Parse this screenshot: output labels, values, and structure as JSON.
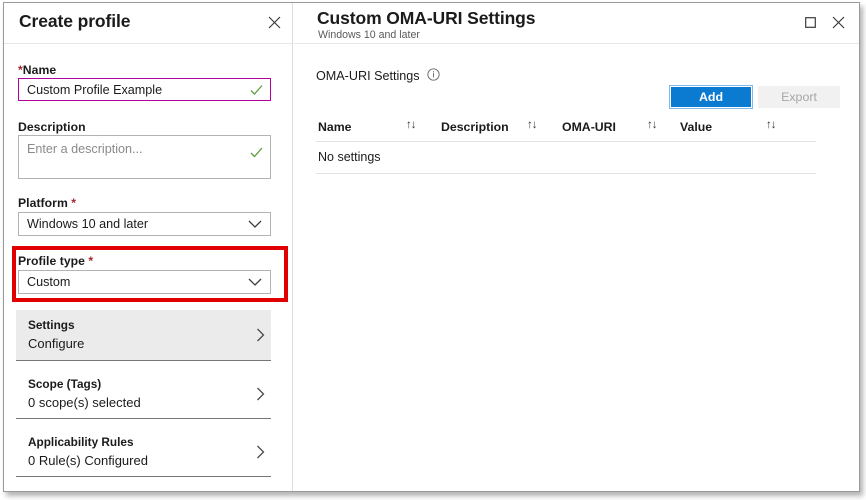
{
  "left_panel": {
    "title": "Create profile",
    "close_icon": "close-icon",
    "name_field": {
      "label": "Name",
      "required_marker": "*",
      "value": "Custom Profile Example",
      "valid_icon": "checkmark-icon"
    },
    "description_field": {
      "label": "Description",
      "placeholder": "Enter a description...",
      "value": "",
      "valid_icon": "checkmark-icon"
    },
    "platform_field": {
      "label": "Platform",
      "required_marker": "*",
      "value": "Windows 10 and later",
      "caret_icon": "chevron-down-icon"
    },
    "profile_type_field": {
      "label": "Profile type",
      "required_marker": "*",
      "value": "Custom",
      "caret_icon": "chevron-down-icon",
      "highlight_color": "#e00000"
    },
    "nav_rows": [
      {
        "title": "Settings",
        "subtitle": "Configure",
        "chevron_icon": "chevron-right-icon",
        "selected": true
      },
      {
        "title": "Scope (Tags)",
        "subtitle": "0 scope(s) selected",
        "chevron_icon": "chevron-right-icon",
        "selected": false
      },
      {
        "title": "Applicability Rules",
        "subtitle": "0 Rule(s) Configured",
        "chevron_icon": "chevron-right-icon",
        "selected": false
      }
    ]
  },
  "right_panel": {
    "title": "Custom OMA-URI Settings",
    "subtitle": "Windows 10 and later",
    "maximize_icon": "maximize-icon",
    "close_icon": "close-icon",
    "section_label": "OMA-URI Settings",
    "info_icon": "info-icon",
    "buttons": {
      "add_label": "Add",
      "add_color": "#0b7ad1",
      "export_label": "Export",
      "export_disabled": true
    },
    "table": {
      "columns": [
        {
          "label": "Name",
          "sort_icon": "sort-updown-icon"
        },
        {
          "label": "Description",
          "sort_icon": "sort-updown-icon"
        },
        {
          "label": "OMA-URI",
          "sort_icon": "sort-updown-icon"
        },
        {
          "label": "Value",
          "sort_icon": "sort-updown-icon"
        }
      ],
      "empty_message": "No settings",
      "rows": []
    }
  }
}
